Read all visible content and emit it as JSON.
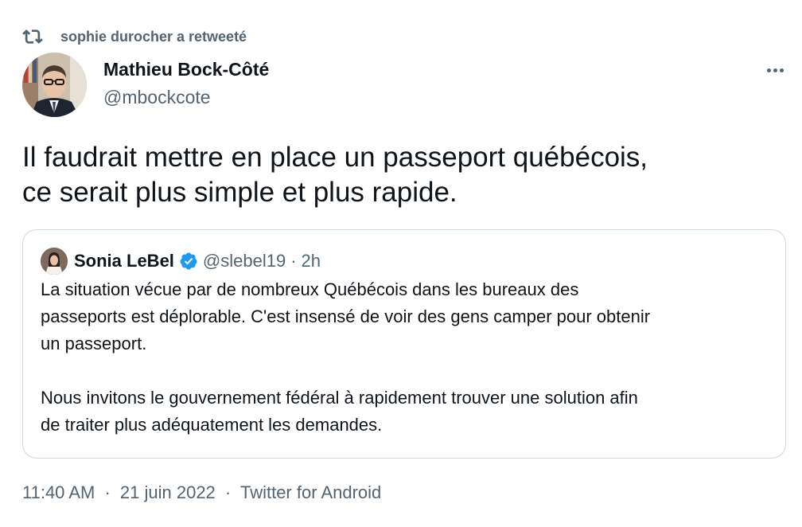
{
  "retweet": {
    "icon": "retweet-icon",
    "text": "sophie durocher a retweeté"
  },
  "author": {
    "name": "Mathieu Bock-Côté",
    "handle": "@mbockcote",
    "avatar_icon": "avatar"
  },
  "tweet": {
    "lines": [
      "Il faudrait mettre en place un passeport québécois,",
      "ce serait plus simple et plus rapide."
    ]
  },
  "quote": {
    "name": "Sonia LeBel",
    "verified_icon": "verified-badge-icon",
    "handle": "@slebel19",
    "separator": "·",
    "time": "2h",
    "paragraph1": [
      "La situation vécue par de nombreux Québécois dans les bureaux des",
      "passeports est déplorable. C'est insensé de voir des gens camper pour obtenir",
      "un passeport."
    ],
    "paragraph2": [
      "Nous invitons le gouvernement fédéral à rapidement trouver une solution afin",
      "de traiter plus adéquatement les demandes."
    ]
  },
  "meta": {
    "time": "11:40 AM",
    "date": "21 juin 2022",
    "source": "Twitter for Android",
    "separator": "·"
  },
  "colors": {
    "text_primary": "#0f1419",
    "text_secondary": "#536471",
    "border": "#cfd9de",
    "verified_blue": "#1d9bf0"
  }
}
